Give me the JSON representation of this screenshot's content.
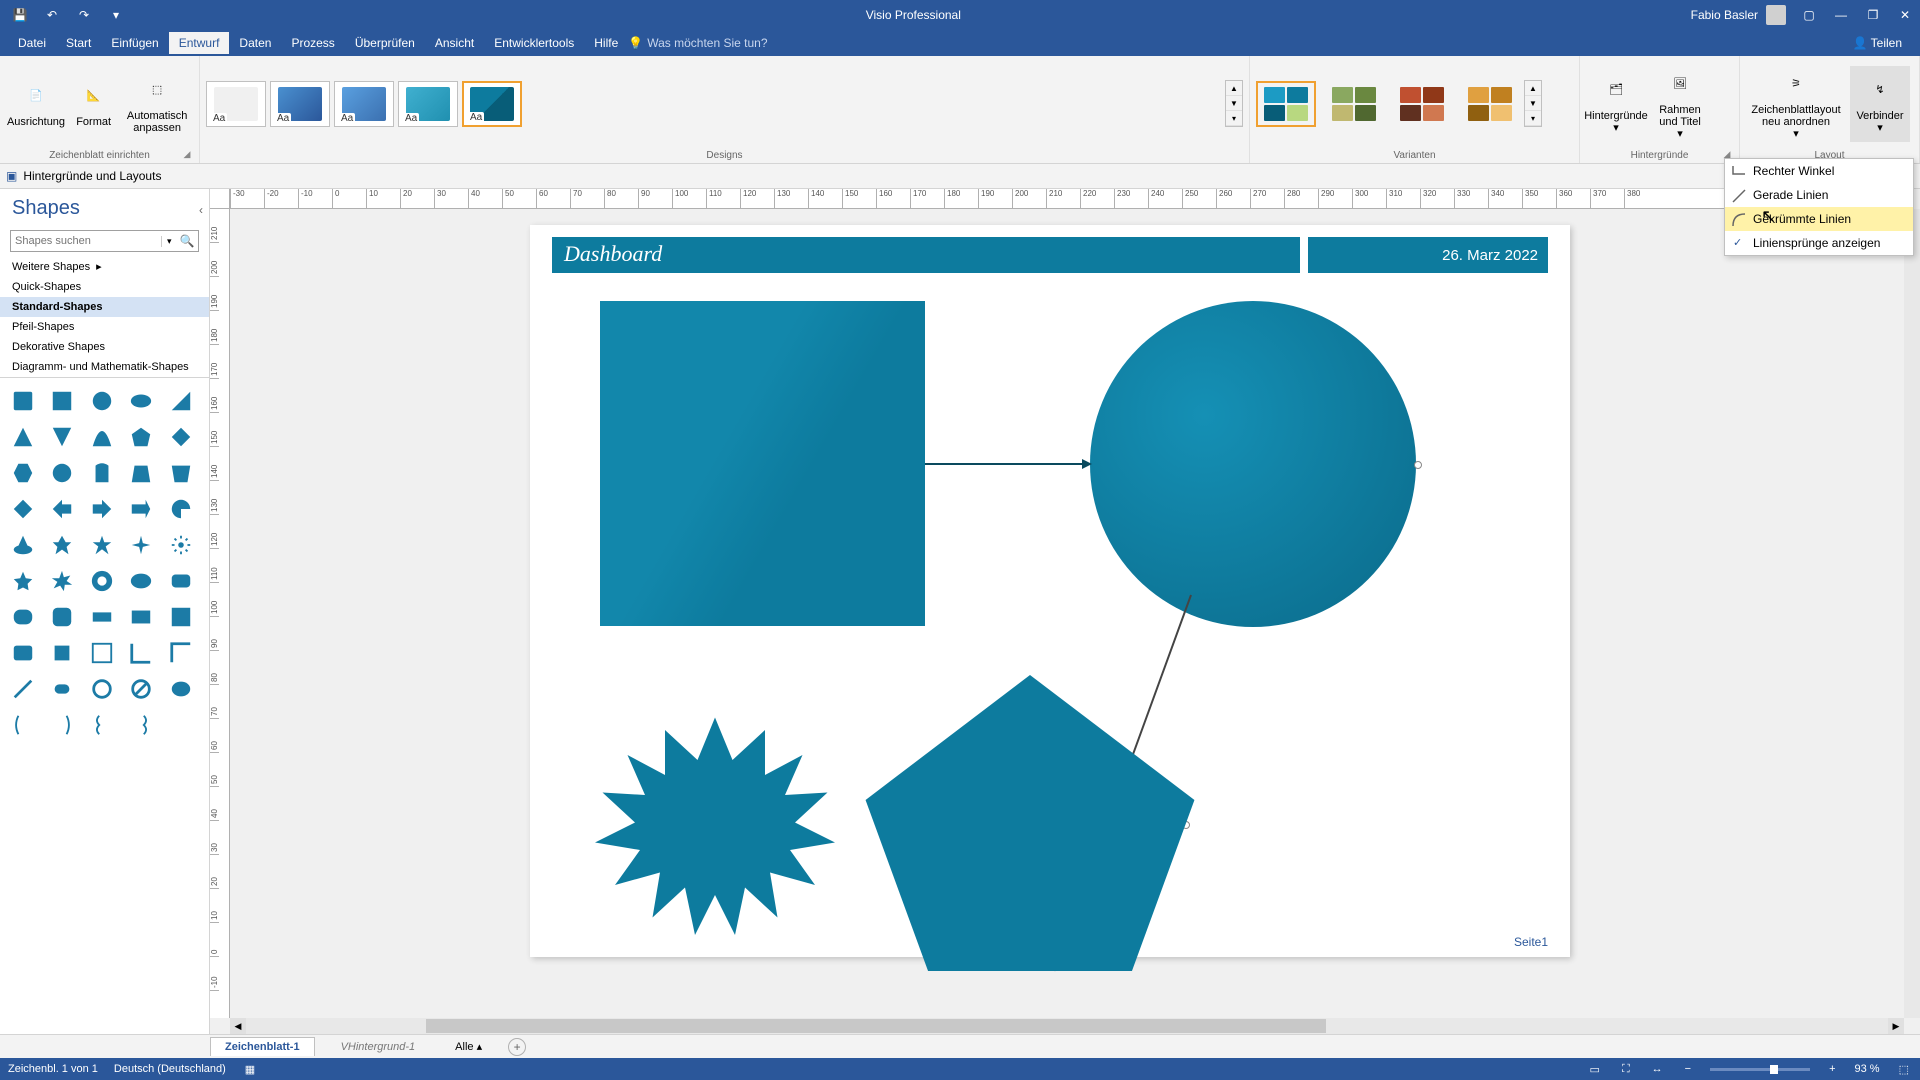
{
  "app": {
    "title": "Visio Professional",
    "user": "Fabio Basler"
  },
  "qat": {
    "save": "💾",
    "undo": "↶",
    "redo": "↷"
  },
  "window": {
    "share": "Teilen",
    "min": "—",
    "restore": "❐",
    "close": "✕",
    "opts": "▢"
  },
  "tabs": {
    "items": [
      "Datei",
      "Start",
      "Einfügen",
      "Entwurf",
      "Daten",
      "Prozess",
      "Überprüfen",
      "Ansicht",
      "Entwicklertools",
      "Hilfe"
    ],
    "active": 3,
    "tellme_icon": "💡",
    "tellme": "Was möchten Sie tun?"
  },
  "ribbon": {
    "g1": {
      "label": "Zeichenblatt einrichten",
      "ausrichtung": "Ausrichtung",
      "format": "Format",
      "auto": "Automatisch anpassen"
    },
    "g2": {
      "label": "Designs"
    },
    "g3": {
      "label": "Varianten"
    },
    "g4": {
      "label": "Hintergründe",
      "hinter": "Hintergründe",
      "rahmen": "Rahmen und Titel"
    },
    "g5": {
      "label": "Layout",
      "neu": "Zeichenblattlayout neu anordnen",
      "verb": "Verbinder"
    }
  },
  "verbinder_menu": {
    "items": [
      "Rechter Winkel",
      "Gerade Linien",
      "Gekrümmte Linien",
      "Liniensprünge anzeigen"
    ],
    "highlighted": 2,
    "checked": 3
  },
  "secbar": {
    "title": "Hintergründe und Layouts",
    "close": "✕"
  },
  "shapes": {
    "title": "Shapes",
    "search_placeholder": "Shapes suchen",
    "stencils": [
      "Weitere Shapes",
      "Quick-Shapes",
      "Standard-Shapes",
      "Pfeil-Shapes",
      "Dekorative Shapes",
      "Diagramm- und Mathematik-Shapes"
    ],
    "selected_stencil": 2
  },
  "canvas": {
    "dashboard_title": "Dashboard",
    "date": "26. Marz 2022",
    "page_label": "Seite1",
    "hruler": [
      "-30",
      "-20",
      "-10",
      "0",
      "10",
      "20",
      "30",
      "40",
      "50",
      "60",
      "70",
      "80",
      "90",
      "100",
      "110",
      "120",
      "130",
      "140",
      "150",
      "160",
      "170",
      "180",
      "190",
      "200",
      "210",
      "220",
      "230",
      "240",
      "250",
      "260",
      "270",
      "280",
      "290",
      "300",
      "310",
      "320",
      "330",
      "340",
      "350",
      "360",
      "370",
      "380"
    ],
    "vruler": [
      "210",
      "200",
      "190",
      "180",
      "170",
      "160",
      "150",
      "140",
      "130",
      "120",
      "110",
      "100",
      "90",
      "80",
      "70",
      "60",
      "50",
      "40",
      "30",
      "20",
      "10",
      "0",
      "-10"
    ]
  },
  "page_tabs": {
    "tabs": [
      "Zeichenblatt-1",
      "VHintergrund-1",
      "Alle"
    ],
    "active": 0
  },
  "status": {
    "sheet": "Zeichenbl. 1 von 1",
    "lang": "Deutsch (Deutschland)",
    "zoom": "93 %",
    "minus": "−",
    "plus": "+"
  }
}
